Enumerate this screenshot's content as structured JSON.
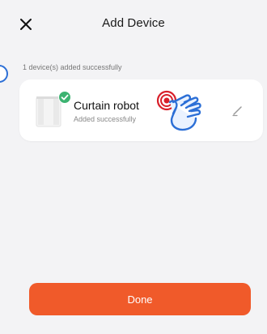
{
  "header": {
    "title": "Add Device",
    "close_icon": "close-icon"
  },
  "status": {
    "text": "1 device(s) added successfully"
  },
  "device": {
    "name": "Curtain robot",
    "subtitle": "Added successfully",
    "check_icon": "check-circle-icon",
    "edit_icon": "pencil-icon"
  },
  "actions": {
    "done_label": "Done"
  },
  "colors": {
    "accent": "#f05a2a",
    "success": "#3cb371",
    "pointer": "#2c6fd6",
    "tap": "#d81f2a"
  }
}
